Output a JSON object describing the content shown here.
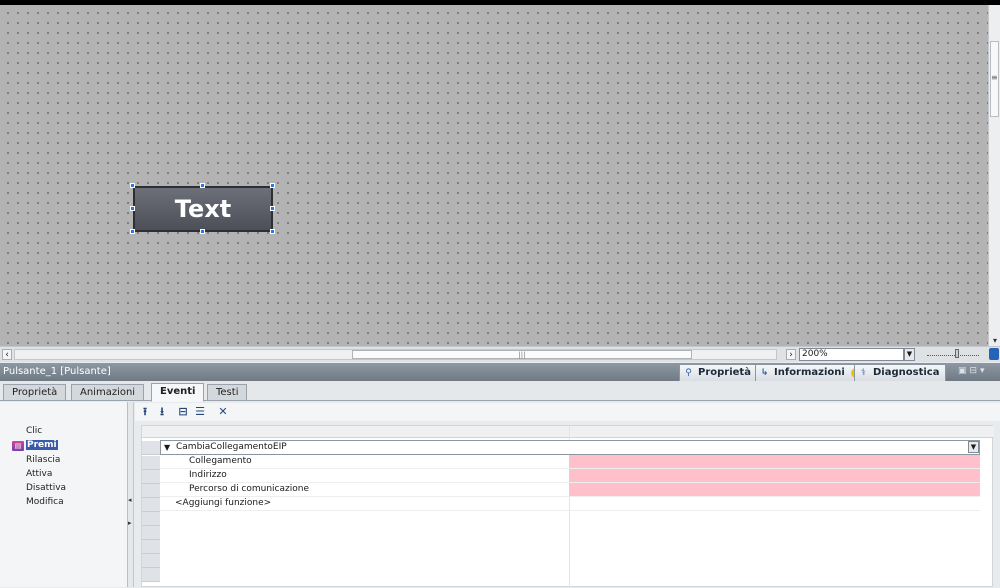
{
  "canvas": {
    "button_text": "Text"
  },
  "zoom": {
    "value": "200%"
  },
  "inspector": {
    "title": "Pulsante_1 [Pulsante]",
    "tabs": {
      "properties": "Proprietà",
      "info": "Informazioni",
      "diagnostics": "Diagnostica"
    },
    "info_badge": "i"
  },
  "property_tabs": [
    "Proprietà",
    "Animazioni",
    "Eventi",
    "Testi"
  ],
  "active_property_tab": "Eventi",
  "events": {
    "items": [
      "Clic",
      "Premi",
      "Rilascia",
      "Attiva",
      "Disattiva",
      "Modifica"
    ],
    "selected": "Premi"
  },
  "function_list": {
    "function_name": "CambiaCollegamentoEIP",
    "parameters": [
      "Collegamento",
      "Indirizzo",
      "Percorso di comunicazione"
    ],
    "add_function": "<Aggiungi funzione>"
  },
  "colors": {
    "canvas_bg": "#b3b3b3",
    "title_bar": "#7d8792",
    "missing_param": "#ffc0cb",
    "selection": "#3a5ba8"
  }
}
